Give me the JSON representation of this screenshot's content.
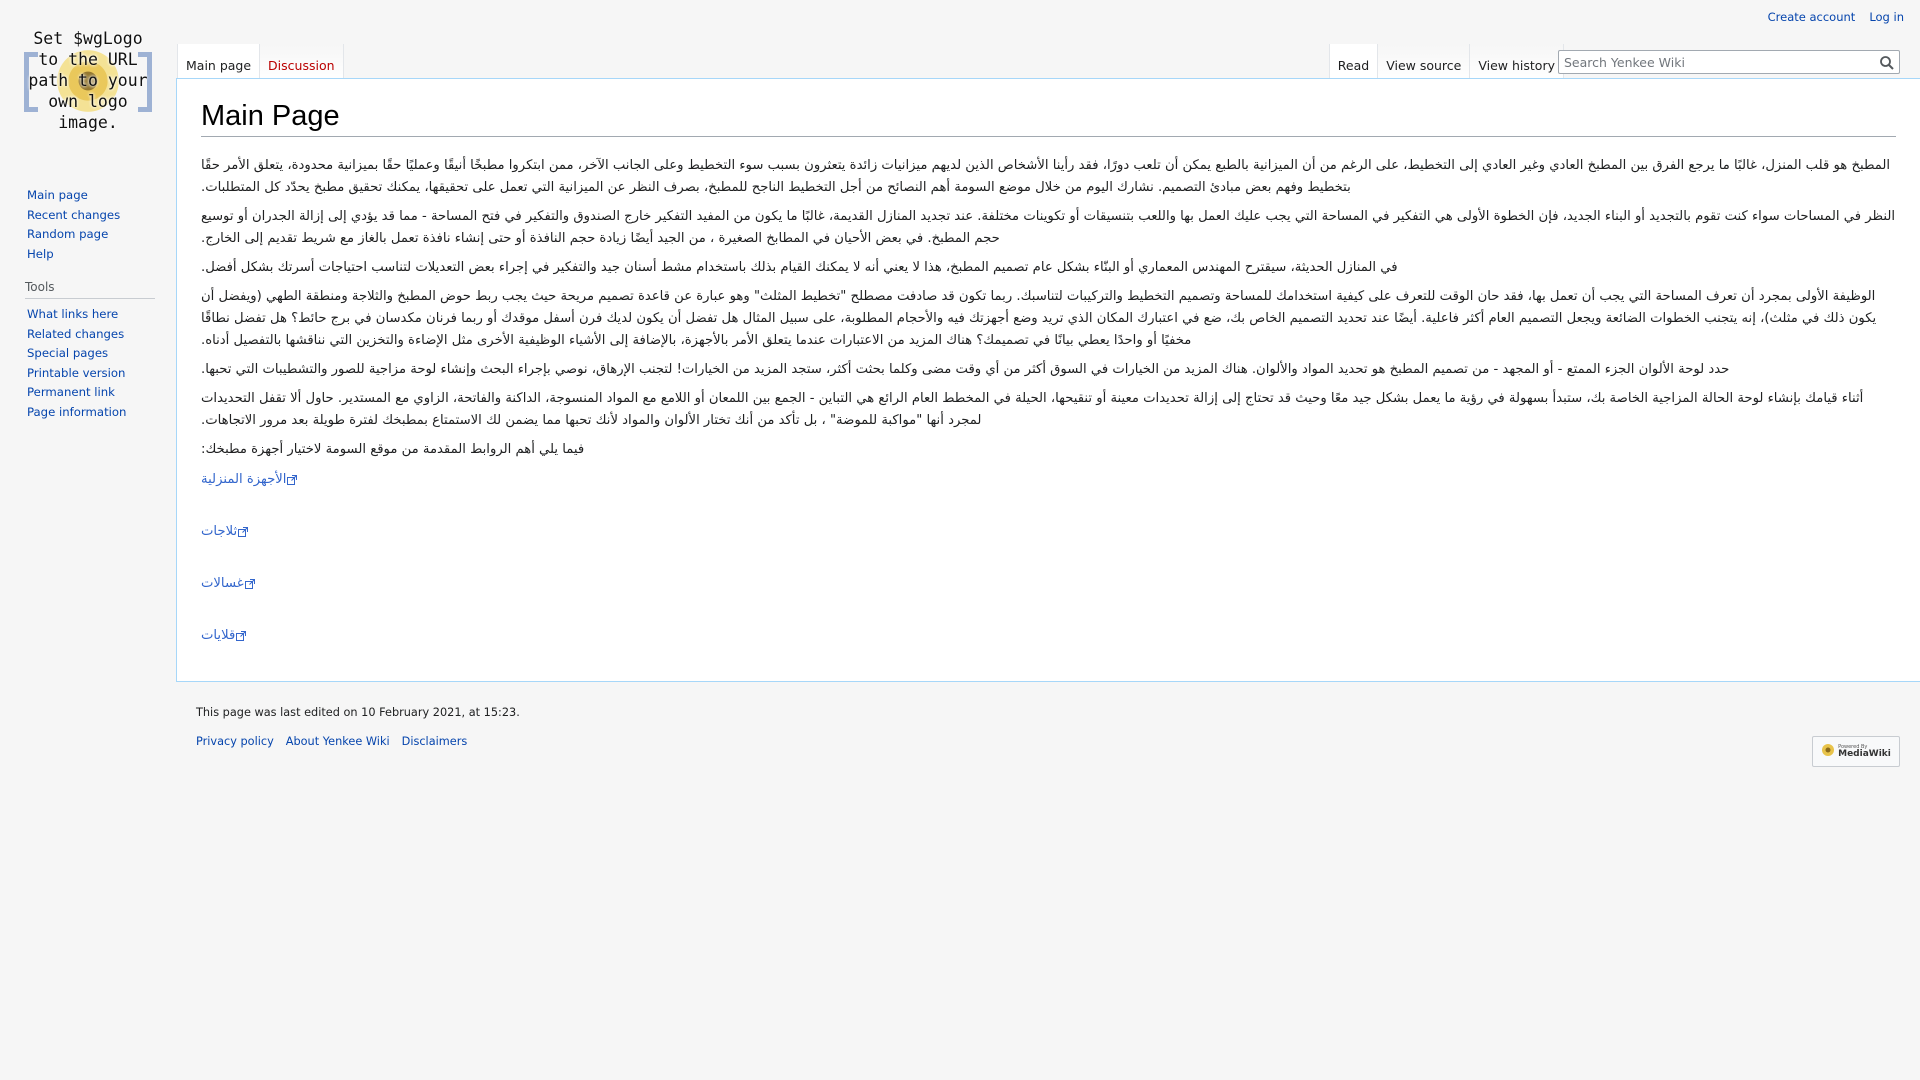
{
  "personal": {
    "create_account": "Create account",
    "log_in": "Log in"
  },
  "logo": {
    "text": "Set $wgLogo to the URL path to your own logo image."
  },
  "tabs": {
    "left": [
      {
        "label": "Main page"
      },
      {
        "label": "Discussion"
      }
    ],
    "right": [
      {
        "label": "Read"
      },
      {
        "label": "View source"
      },
      {
        "label": "View history"
      }
    ]
  },
  "search": {
    "placeholder": "Search Yenkee Wiki",
    "icon": "search-icon"
  },
  "sidebar": {
    "navigation": [
      {
        "label": "Main page"
      },
      {
        "label": "Recent changes"
      },
      {
        "label": "Random page"
      },
      {
        "label": "Help"
      }
    ],
    "tools_heading": "Tools",
    "tools": [
      {
        "label": "What links here"
      },
      {
        "label": "Related changes"
      },
      {
        "label": "Special pages"
      },
      {
        "label": "Printable version"
      },
      {
        "label": "Permanent link"
      },
      {
        "label": "Page information"
      }
    ]
  },
  "page": {
    "title": "Main Page",
    "paragraphs": [
      "المطبخ هو قلب المنزل، غالبًا ما يرجع الفرق بين المطبخ العادي وغير العادي إلى التخطيط، على الرغم من أن الميزانية بالطبع يمكن أن تلعب دورًا، فقد رأينا الأشخاص الذين لديهم ميزانيات زائدة يتعثرون بسبب سوء التخطيط وعلى الجانب الآخر، ممن ابتكروا مطبخًا أنيقًا وعمليًا حقًا بميزانية محدودة، يتعلق الأمر حقًا بتخطيط وفهم بعض مبادئ التصميم. نشارك اليوم من خلال موضع السومة أهم النصائح من أجل التخطيط الناجح للمطبخ، بصرف النظر عن الميزانية التي تعمل على تحقيقها، يمكنك تحقيق مطبخ يحدّد كل المتطلبات.",
      "النظر في المساحات سواء كنت تقوم بالتجديد أو البناء الجديد، فإن الخطوة الأولى هي التفكير في المساحة التي يجب عليك العمل بها واللعب بتنسيقات أو تكوينات مختلفة. عند تجديد المنازل القديمة، غالبًا ما يكون من المفيد التفكير خارج الصندوق والتفكير في فتح المساحة - مما قد يؤدي إلى إزالة الجدران أو توسيع حجم المطبخ. في بعض الأحيان في المطابخ الصغيرة ، من الجيد أيضًا زيادة حجم النافذة أو حتى إنشاء نافذة تعمل بالغاز مع شريط تقديم إلى الخارج.",
      "في المنازل الحديثة، سيقترح المهندس المعماري أو البنّاء بشكل عام تصميم المطبخ، هذا لا يعني أنه لا يمكنك القيام بذلك باستخدام مشط أسنان جيد والتفكير في إجراء بعض التعديلات لتناسب احتياجات أسرتك بشكل أفضل.",
      "الوظيفة الأولى بمجرد أن تعرف المساحة التي يجب أن تعمل بها، فقد حان الوقت للتعرف على كيفية استخدامك للمساحة وتصميم التخطيط والتركيبات لتناسبك. ربما تكون قد صادفت مصطلح \"تخطيط المثلث\" وهو عبارة عن قاعدة تصميم مريحة حيث يجب ربط حوض المطبخ والثلاجة ومنطقة الطهي (ويفضل أن يكون ذلك في مثلث)، إنه يتجنب الخطوات الضائعة ويجعل التصميم العام أكثر فاعلية. أيضًا عند تحديد التصميم الخاص بك، ضع في اعتبارك المكان الذي تريد وضع أجهزتك فيه والأحجام المطلوبة، على سبيل المثال هل تفضل أن يكون لديك فرن أسفل موقدك أو ربما فرنان مكدسان في برج حائط؟ هل تفضل نطاقًا مخفيًا أو واحدًا يعطي بيانًا في تصميمك؟ هناك المزيد من الاعتبارات عندما يتعلق الأمر بالأجهزة، بالإضافة إلى الأشياء الوظيفية الأخرى مثل الإضاءة والتخزين التي نناقشها بالتفصيل أدناه.",
      "حدد لوحة الألوان الجزء الممتع - أو المجهد - من تصميم المطبخ هو تحديد المواد والألوان. هناك المزيد من الخيارات في السوق أكثر من أي وقت مضى وكلما بحثت أكثر، ستجد المزيد من الخيارات! لتجنب الإرهاق، نوصي بإجراء البحث وإنشاء لوحة مزاجية للصور والتشطيبات التي تحبها.",
      "أثناء قيامك بإنشاء لوحة الحالة المزاجية الخاصة بك، ستبدأ بسهولة في رؤية ما يعمل بشكل جيد معًا وحيث قد تحتاج إلى إزالة تحديدات معينة أو تنقيحها، الحيلة في المخطط العام الرائع هي التباين - الجمع بين اللمعان أو اللامع مع المواد المنسوجة، الداكنة والفاتحة، الزاوي مع المستدير. حاول ألا تقفل التحديدات لمجرد أنها \"مواكبة للموضة\" ، بل تأكد من أنك تختار الألوان والمواد لأنك تحبها مما يضمن لك الاستمتاع بمطبخك لفترة طويلة بعد مرور الاتجاهات.",
      "فيما يلي أهم الروابط المقدمة من موقع السومة لاختيار أجهزة مطبخك:"
    ],
    "links": [
      {
        "label": "الأجهزة المنزلية"
      },
      {
        "label": "ثلاجات"
      },
      {
        "label": "غسالات"
      },
      {
        "label": "قلايات"
      }
    ]
  },
  "footer": {
    "last_modified": "This page was last edited on 10 February 2021, at 15:23.",
    "links": [
      {
        "label": "Privacy policy"
      },
      {
        "label": "About Yenkee Wiki"
      },
      {
        "label": "Disclaimers"
      }
    ],
    "powered_by_small": "Powered By",
    "powered_by_big": "MediaWiki"
  }
}
